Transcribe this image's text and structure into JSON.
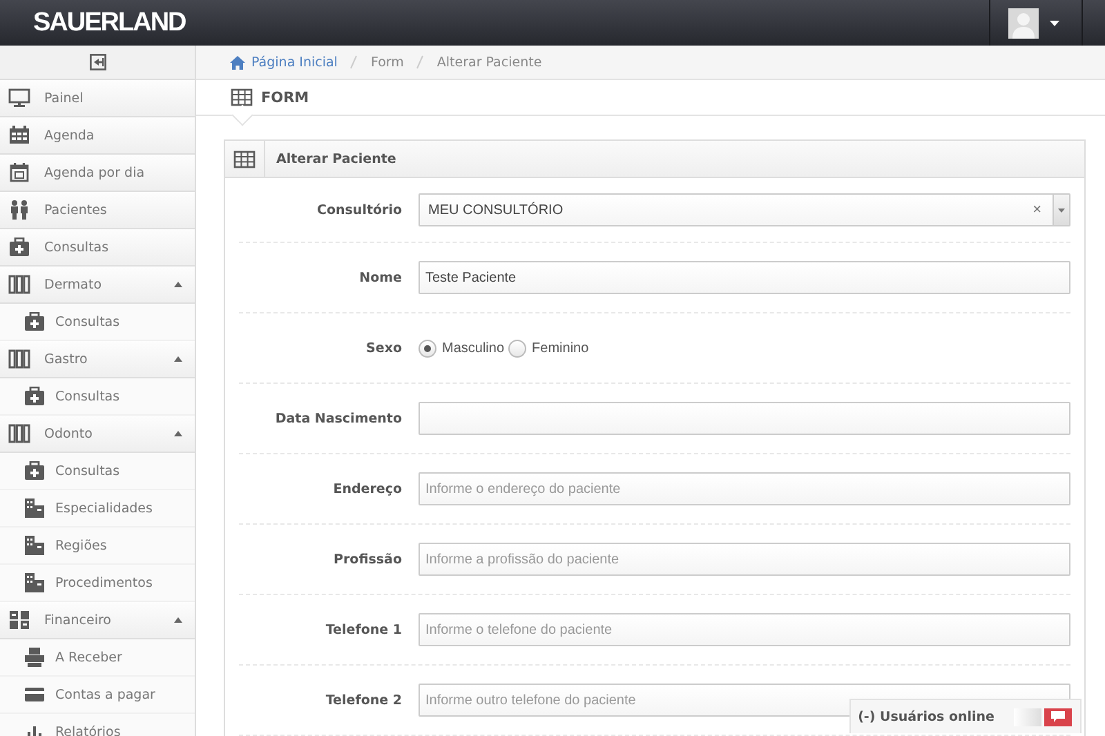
{
  "header": {
    "brand": "SAUERLAND"
  },
  "sidebar": {
    "items": [
      {
        "label": "Painel",
        "kind": "item"
      },
      {
        "label": "Agenda",
        "kind": "item"
      },
      {
        "label": "Agenda por dia",
        "kind": "item"
      },
      {
        "label": "Pacientes",
        "kind": "item"
      },
      {
        "label": "Consultas",
        "kind": "item"
      },
      {
        "label": "Dermato",
        "kind": "group",
        "expanded": true,
        "children": [
          {
            "label": "Consultas"
          }
        ]
      },
      {
        "label": "Gastro",
        "kind": "group",
        "expanded": true,
        "children": [
          {
            "label": "Consultas"
          }
        ]
      },
      {
        "label": "Odonto",
        "kind": "group",
        "expanded": true,
        "children": [
          {
            "label": "Consultas"
          },
          {
            "label": "Especialidades"
          },
          {
            "label": "Regiões"
          },
          {
            "label": "Procedimentos"
          }
        ]
      },
      {
        "label": "Financeiro",
        "kind": "group",
        "expanded": true,
        "children": [
          {
            "label": "A Receber"
          },
          {
            "label": "Contas a pagar"
          },
          {
            "label": "Relatórios"
          }
        ]
      }
    ]
  },
  "breadcrumb": [
    {
      "label": "Página Inicial"
    },
    {
      "label": "Form"
    },
    {
      "label": "Alterar Paciente"
    }
  ],
  "page_title": "FORM",
  "panel": {
    "title": "Alterar Paciente",
    "fields": [
      {
        "label": "Consultório",
        "kind": "select",
        "value": "MEU CONSULTÓRIO",
        "clear": "×"
      },
      {
        "label": "Nome",
        "kind": "text",
        "value": "Teste Paciente"
      },
      {
        "label": "Sexo",
        "kind": "radio",
        "options": [
          {
            "label": "Masculino",
            "selected": true
          },
          {
            "label": "Feminino",
            "selected": false
          }
        ]
      },
      {
        "label": "Data Nascimento",
        "kind": "text"
      },
      {
        "label": "Endereço",
        "kind": "text",
        "placeholder": "Informe o endereço do paciente"
      },
      {
        "label": "Profissão",
        "kind": "text",
        "placeholder": "Informe a profissão do paciente"
      },
      {
        "label": "Telefone 1",
        "kind": "text",
        "placeholder": "Informe o telefone do paciente"
      },
      {
        "label": "Telefone 2",
        "kind": "text",
        "placeholder": "Informe outro telefone do paciente"
      }
    ]
  },
  "chat": {
    "label": "(-) Usuários online",
    "online": false
  }
}
